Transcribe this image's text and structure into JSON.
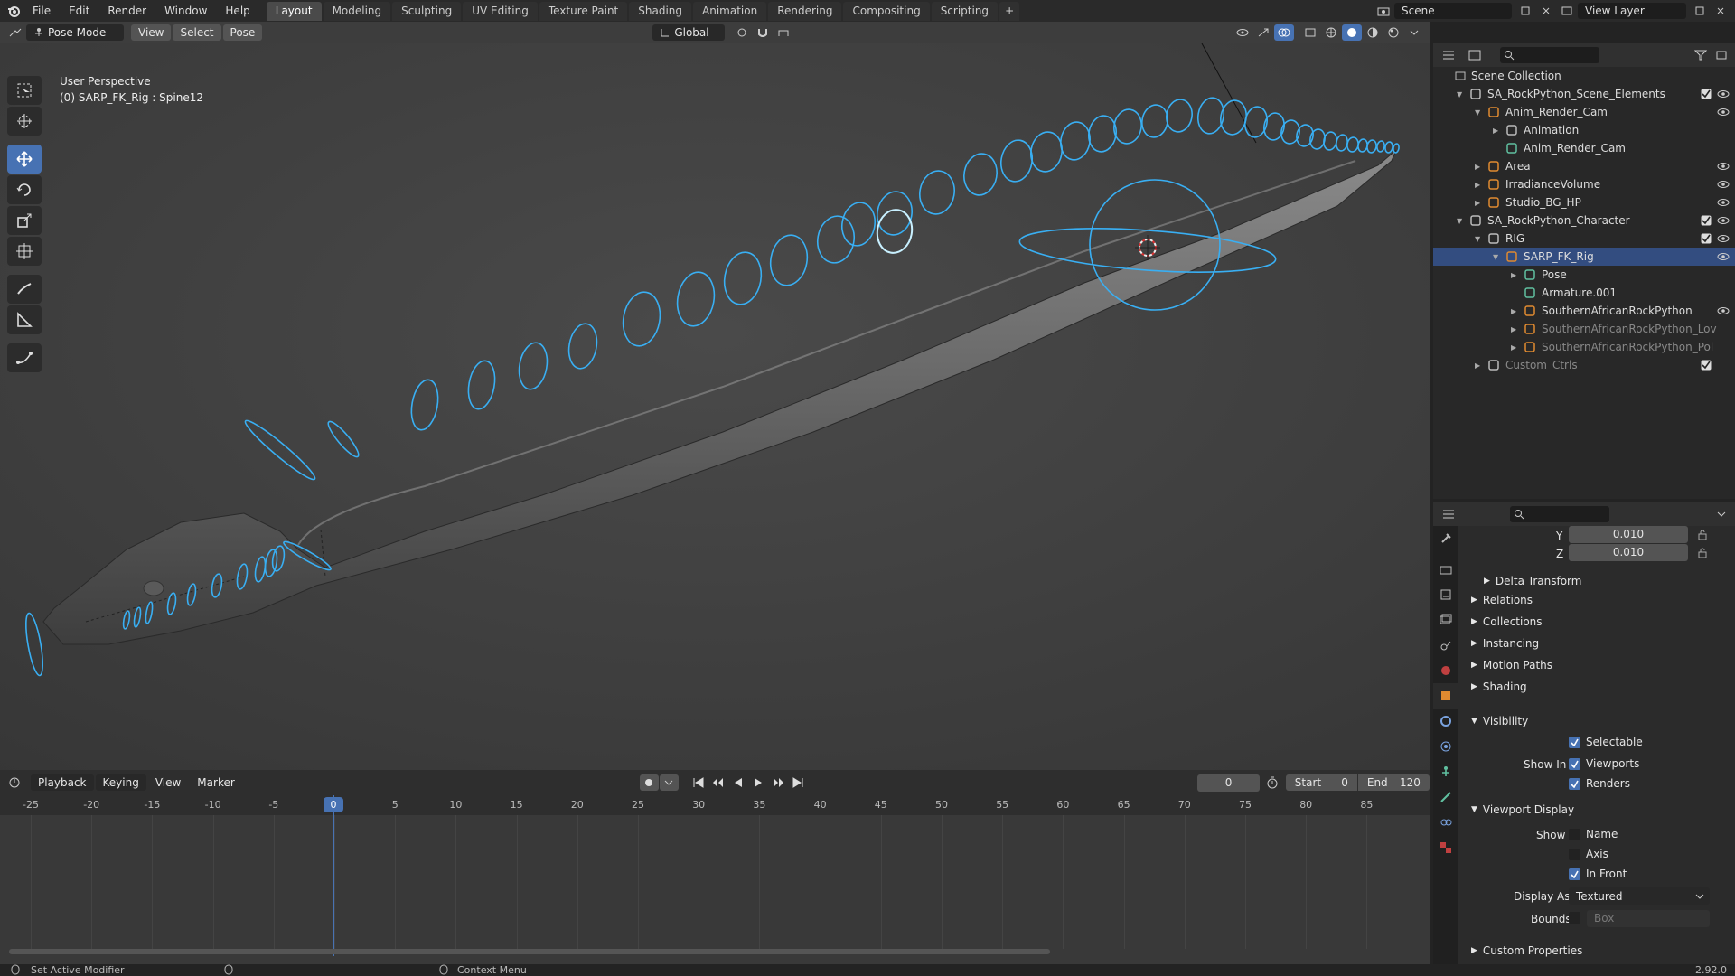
{
  "menus": [
    "File",
    "Edit",
    "Render",
    "Window",
    "Help"
  ],
  "workspaces": [
    "Layout",
    "Modeling",
    "Sculpting",
    "UV Editing",
    "Texture Paint",
    "Shading",
    "Animation",
    "Rendering",
    "Compositing",
    "Scripting"
  ],
  "active_workspace": "Layout",
  "scene": "Scene",
  "view_layer": "View Layer",
  "viewport_header": {
    "mode": "Pose Mode",
    "view": "View",
    "select": "Select",
    "pose": "Pose",
    "orientation": "Global"
  },
  "viewport_overlay": {
    "line1": "User Perspective",
    "line2": "(0) SARP_FK_Rig : Spine12"
  },
  "timeline": {
    "playback": "Playback",
    "keying": "Keying",
    "view": "View",
    "marker": "Marker",
    "current_frame": "0",
    "start_label": "Start",
    "start": "0",
    "end_label": "End",
    "end": "120",
    "ticks": [
      "-25",
      "-20",
      "-15",
      "-10",
      "-5",
      "0",
      "5",
      "10",
      "15",
      "20",
      "25",
      "30",
      "35",
      "40",
      "45",
      "50",
      "55",
      "60",
      "65",
      "70",
      "75",
      "80",
      "85"
    ],
    "cursor_label": "0"
  },
  "outliner": {
    "root": "Scene Collection",
    "rows": [
      {
        "label": "SA_RockPython_Scene_Elements"
      },
      {
        "label": "Anim_Render_Cam"
      },
      {
        "label": "Animation"
      },
      {
        "label": "Anim_Render_Cam"
      },
      {
        "label": "Area"
      },
      {
        "label": "IrradianceVolume"
      },
      {
        "label": "Studio_BG_HP"
      },
      {
        "label": "SA_RockPython_Character"
      },
      {
        "label": "RIG"
      },
      {
        "label": "SARP_FK_Rig"
      },
      {
        "label": "Pose"
      },
      {
        "label": "Armature.001"
      },
      {
        "label": "SouthernAfricanRockPython"
      },
      {
        "label": "SouthernAfricanRockPython_Lov"
      },
      {
        "label": "SouthernAfricanRockPython_Pol"
      },
      {
        "label": "Custom_Ctrls"
      }
    ]
  },
  "properties": {
    "y_label": "Y",
    "y_value": "0.010",
    "z_label": "Z",
    "z_value": "0.010",
    "delta_transform": "Delta Transform",
    "sections": [
      "Relations",
      "Collections",
      "Instancing",
      "Motion Paths",
      "Shading"
    ],
    "visibility": "Visibility",
    "selectable": "Selectable",
    "show_in": "Show In",
    "viewports": "Viewports",
    "renders": "Renders",
    "viewport_display": "Viewport Display",
    "show": "Show",
    "name": "Name",
    "axis": "Axis",
    "in_front": "In Front",
    "display_as_label": "Display As",
    "display_as": "Textured",
    "bounds_label": "Bounds",
    "bounds": "Box",
    "custom_properties": "Custom Properties"
  },
  "status": {
    "left": "Set Active Modifier",
    "mid": "Context Menu",
    "version": "2.92.0"
  }
}
